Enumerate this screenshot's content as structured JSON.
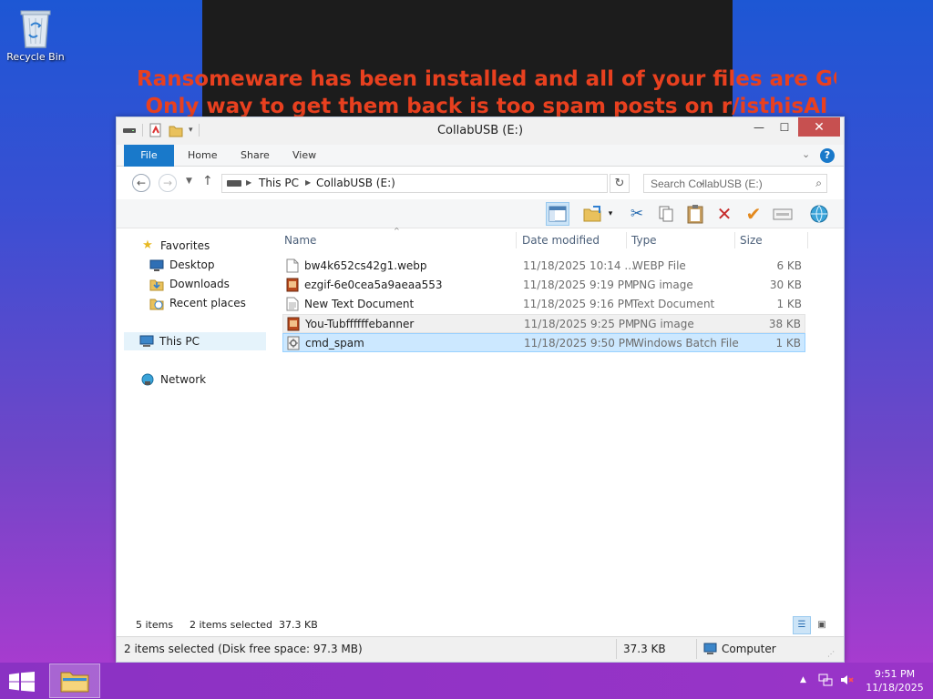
{
  "desktop": {
    "recycle_bin_label": "Recycle Bin",
    "wallpaper_line1": "Ransomeware has been installed and all of your files are GONE",
    "wallpaper_line2": "Only way to get them back is too spam posts on r/isthisAI"
  },
  "window": {
    "title": "CollabUSB (E:)",
    "controls": {
      "minimize": "—",
      "maximize": "☐",
      "close": "✕"
    }
  },
  "ribbon": {
    "tabs": [
      {
        "label": "File"
      },
      {
        "label": "Home"
      },
      {
        "label": "Share"
      },
      {
        "label": "View"
      }
    ],
    "help": "?"
  },
  "address": {
    "crumbs": [
      "This PC",
      "CollabUSB (E:)"
    ],
    "search_placeholder": "Search CollabUSB (E:)"
  },
  "nav_pane": {
    "favorites": "Favorites",
    "desktop": "Desktop",
    "downloads": "Downloads",
    "recent": "Recent places",
    "this_pc": "This PC",
    "network": "Network"
  },
  "columns": {
    "name": "Name",
    "date": "Date modified",
    "type": "Type",
    "size": "Size"
  },
  "files": [
    {
      "name": "bw4k652cs42g1.webp",
      "date": "11/18/2025 10:14 ...",
      "type": "WEBP File",
      "size": "6 KB",
      "icon": "blank-file-icon"
    },
    {
      "name": "ezgif-6e0cea5a9aeaa553",
      "date": "11/18/2025 9:19 PM",
      "type": "PNG image",
      "size": "30 KB",
      "icon": "image-file-icon"
    },
    {
      "name": "New Text Document",
      "date": "11/18/2025 9:16 PM",
      "type": "Text Document",
      "size": "1 KB",
      "icon": "text-file-icon"
    },
    {
      "name": "You-Tubffffffebanner",
      "date": "11/18/2025 9:25 PM",
      "type": "PNG image",
      "size": "38 KB",
      "icon": "image-file-icon"
    },
    {
      "name": "cmd_spam",
      "date": "11/18/2025 9:50 PM",
      "type": "Windows Batch File",
      "size": "1 KB",
      "icon": "batch-file-icon"
    }
  ],
  "status": {
    "items": "5 items",
    "selected": "2 items selected  37.3 KB",
    "bar_left": "2 items selected (Disk free space: 97.3 MB)",
    "bar_size": "37.3 KB",
    "bar_location": "Computer"
  },
  "taskbar": {
    "time": "9:51 PM",
    "date": "11/18/2025"
  },
  "colors": {
    "accent": "#1979ca",
    "selection": "#cce8ff",
    "taskbar": "#9234c6",
    "ransom_text": "#e8401f"
  }
}
